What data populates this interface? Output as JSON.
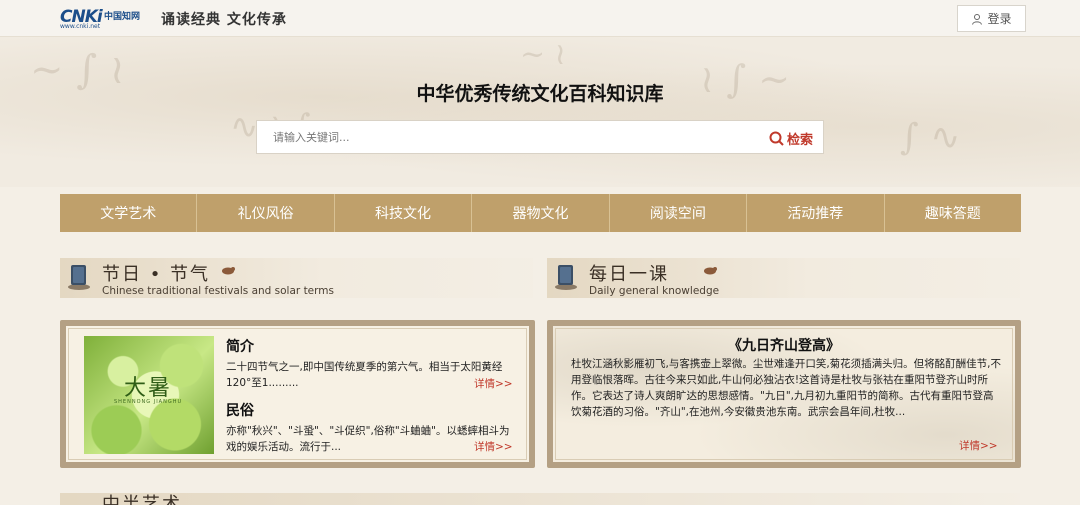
{
  "header": {
    "logo_mark": "CNKi",
    "logo_cn": "中国知网",
    "logo_url": "www.cnki.net",
    "slogan": "诵读经典 文化传承",
    "login_label": "登录"
  },
  "hero": {
    "title": "中华优秀传统文化百科知识库",
    "search_placeholder": "请输入关键词...",
    "search_button": "检索"
  },
  "nav": {
    "items": [
      "文学艺术",
      "礼仪风俗",
      "科技文化",
      "器物文化",
      "阅读空间",
      "活动推荐",
      "趣味答题"
    ]
  },
  "festivals": {
    "title": "节日 • 节气",
    "subtitle": "Chinese traditional festivals and solar terms",
    "image_title": "大暑",
    "image_sub": "SHENNONG JIANGHU",
    "intro_head": "简介",
    "intro_text": "二十四节气之一,即中国传统夏季的第六气。相当于太阳黄经120°至1.........",
    "intro_more": "详情>>",
    "custom_head": "民俗",
    "custom_text": "亦称\"秋兴\"、\"斗蛩\"、\"斗促织\",俗称\"斗蛐蛐\"。以蟋蟀相斗为戏的娱乐活动。流行于...",
    "custom_more": "详情>>"
  },
  "daily": {
    "title": "每日一课",
    "subtitle": "Daily general knowledge",
    "poem_title": "《九日齐山登高》",
    "poem_text": "杜牧江涵秋影雁初飞,与客携壶上翠微。尘世难逢开口笑,菊花须插满头归。但将酩酊酬佳节,不用登临恨落晖。古往今来只如此,牛山何必独沾衣!这首诗是杜牧与张祜在重阳节登齐山时所作。它表达了诗人爽朗旷达的思想感情。\"九日\",九月初九重阳节的简称。古代有重阳节登高饮菊花酒的习俗。\"齐山\",在池州,今安徽贵池东南。武宗会昌年间,杜牧...",
    "more": "详情>>"
  },
  "bottom_section": {
    "title": "中半艺术"
  }
}
